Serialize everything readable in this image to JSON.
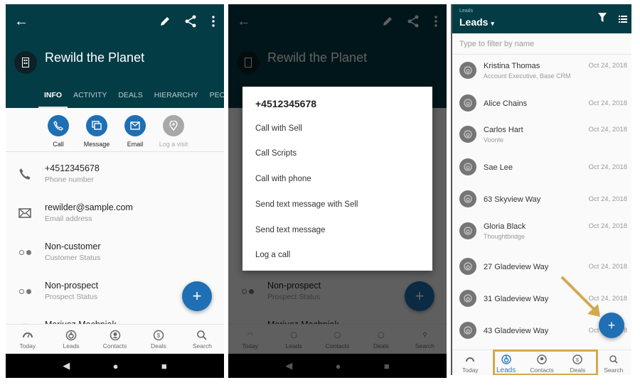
{
  "detail": {
    "title": "Rewild the Planet",
    "tabs": [
      "INFO",
      "ACTIVITY",
      "DEALS",
      "HIERARCHY",
      "PEOPLE"
    ],
    "active_tab": "INFO",
    "actions": [
      {
        "label": "Call",
        "icon": "phone-icon",
        "enabled": true
      },
      {
        "label": "Message",
        "icon": "message-icon",
        "enabled": true
      },
      {
        "label": "Email",
        "icon": "email-icon",
        "enabled": true
      },
      {
        "label": "Log a visit",
        "icon": "location-pin-icon",
        "enabled": false
      }
    ],
    "fields": [
      {
        "value": "+4512345678",
        "label": "Phone number",
        "icon": "phone-icon"
      },
      {
        "value": "rewilder@sample.com",
        "label": "Email address",
        "icon": "envelope-icon"
      },
      {
        "value": "Non-customer",
        "label": "Customer Status",
        "icon": "status-dots-icon"
      },
      {
        "value": "Non-prospect",
        "label": "Prospect Status",
        "icon": "status-dots-icon"
      },
      {
        "value": "Mariusz Machniak",
        "label": "",
        "icon": "avatar-icon"
      }
    ],
    "fab": "+"
  },
  "bottom_nav": [
    "Today",
    "Leads",
    "Contacts",
    "Deals",
    "Search"
  ],
  "phone_menu": {
    "title": "+4512345678",
    "items": [
      "Call with Sell",
      "Call Scripts",
      "Call with phone",
      "Send text message with Sell",
      "Send text message",
      "Log a call"
    ]
  },
  "leads": {
    "small_title": "Leads",
    "title": "Leads",
    "filter_placeholder": "Type to filter by name",
    "items": [
      {
        "name": "Kristina Thomas",
        "sub": "Account Executive, Base CRM",
        "date": "Oct 24, 2018"
      },
      {
        "name": "Alice Chains",
        "sub": "",
        "date": "Oct 24, 2018"
      },
      {
        "name": "Carlos Hart",
        "sub": "Voonte",
        "date": "Oct 24, 2018"
      },
      {
        "name": "Sae Lee",
        "sub": "",
        "date": "Oct 24, 2018"
      },
      {
        "name": "63 Skyview Way",
        "sub": "",
        "date": "Oct 24, 2018"
      },
      {
        "name": "Gloria Black",
        "sub": "Thoughtbridge",
        "date": "Oct 24, 2018"
      },
      {
        "name": "27 Gladeview Way",
        "sub": "",
        "date": "Oct 24, 2018"
      },
      {
        "name": "31 Gladeview Way",
        "sub": "",
        "date": "Oct 24, 2018"
      },
      {
        "name": "43 Gladeview Way",
        "sub": "",
        "date": "Oct 24, 2018"
      }
    ],
    "active_nav": "Leads"
  },
  "colors": {
    "header": "#043c45",
    "accent": "#1e6fb4",
    "highlight": "#d3a94f"
  }
}
